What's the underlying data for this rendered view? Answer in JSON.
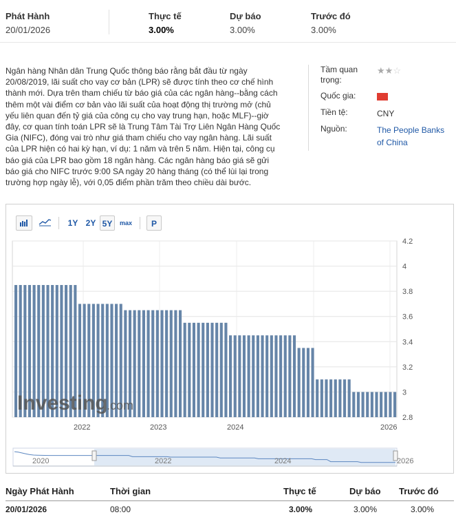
{
  "summary": {
    "release_label": "Phát Hành",
    "release_date": "20/01/2026",
    "actual_label": "Thực tế",
    "actual_value": "3.00%",
    "forecast_label": "Dự báo",
    "forecast_value": "3.00%",
    "previous_label": "Trước đó",
    "previous_value": "3.00%"
  },
  "description": "Ngân hàng Nhân dân Trung Quốc thông báo rằng bắt đầu từ ngày 20/08/2019, lãi suất cho vay cơ bản (LPR) sẽ được tính theo cơ chế hình thành mới. Dựa trên tham chiếu từ báo giá của các ngân hàng--bằng cách thêm một vài điểm cơ bản vào lãi suất của hoạt động thị trường mở (chủ yếu liên quan đến tỷ giá của công cụ cho vay trung hạn, hoặc MLF)--giờ đây, cơ quan tính toán LPR sẽ là Trung Tâm Tài Trợ Liên Ngân Hàng Quốc Gia (NIFC), đóng vai trò như giá tham chiếu cho vay ngân hàng. Lãi suất của LPR hiện có hai kỳ hạn, ví dụ: 1 năm và trên 5 năm. Hiện tại, công cụ báo giá của LPR bao gồm 18 ngân hàng. Các ngân hàng báo giá sẽ gửi báo giá cho NIFC trước 9:00 SA ngày 20 hàng tháng (có thể lùi lại trong trường hợp ngày lễ), với 0,05 điểm phần trăm theo chiều dài bước.",
  "info": {
    "importance_label": "Tầm quan trọng:",
    "importance_stars": 2,
    "country_label": "Quốc gia:",
    "currency_label": "Tiền tệ:",
    "currency_value": "CNY",
    "source_label": "Nguồn:",
    "source_value": "The People Banks of China"
  },
  "toolbar": {
    "bar_icon": "bar-chart-icon",
    "line_icon": "line-chart-icon",
    "range_1y": "1Y",
    "range_2y": "2Y",
    "range_5y": "5Y",
    "range_max": "max",
    "p_button": "P"
  },
  "watermark": {
    "brand": "Investing",
    "suffix": ".com"
  },
  "navigator": {
    "labels": [
      "2020",
      "2022",
      "2024",
      "2026"
    ]
  },
  "colors": {
    "bar": "#6685a8",
    "link": "#1f58a6",
    "flag": "#e03c31",
    "navigator_fill": "#dfe9f5"
  },
  "table": {
    "headers": [
      "Ngày Phát Hành",
      "Thời gian",
      "Thực tế",
      "Dự báo",
      "Trước đó"
    ],
    "rows": [
      [
        "20/01/2026",
        "08:00",
        "3.00%",
        "3.00%",
        "3.00%"
      ]
    ]
  },
  "chart_data": {
    "type": "bar",
    "x_tick_labels": [
      "2022",
      "2023",
      "2024",
      "2026"
    ],
    "y_tick_labels": [
      "2.8",
      "3",
      "3.2",
      "3.4",
      "3.6",
      "3.8",
      "4",
      "4.2"
    ],
    "ylim": [
      2.8,
      4.2
    ],
    "grid": true,
    "y_axis_position": "right",
    "series": [
      {
        "values": [
          3.85,
          3.85,
          3.85,
          3.85,
          3.85,
          3.85,
          3.85,
          3.85,
          3.85,
          3.85,
          3.85,
          3.85,
          3.85,
          3.85,
          3.7,
          3.7,
          3.7,
          3.7,
          3.7,
          3.7,
          3.7,
          3.7,
          3.7,
          3.7,
          3.65,
          3.65,
          3.65,
          3.65,
          3.65,
          3.65,
          3.65,
          3.65,
          3.65,
          3.65,
          3.65,
          3.65,
          3.65,
          3.55,
          3.55,
          3.55,
          3.55,
          3.55,
          3.55,
          3.55,
          3.55,
          3.55,
          3.55,
          3.45,
          3.45,
          3.45,
          3.45,
          3.45,
          3.45,
          3.45,
          3.45,
          3.45,
          3.45,
          3.45,
          3.45,
          3.45,
          3.45,
          3.45,
          3.35,
          3.35,
          3.35,
          3.35,
          3.1,
          3.1,
          3.1,
          3.1,
          3.1,
          3.1,
          3.1,
          3.1,
          3.0,
          3.0,
          3.0,
          3.0,
          3.0,
          3.0,
          3.0,
          3.0,
          3.0,
          3.0
        ]
      }
    ]
  }
}
